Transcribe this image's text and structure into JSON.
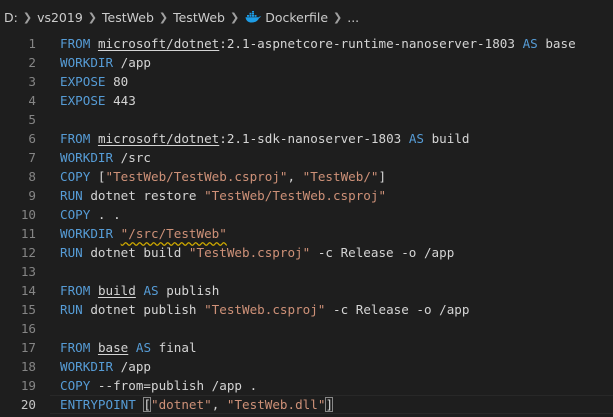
{
  "breadcrumb": [
    {
      "name": "drive",
      "label": "D:"
    },
    {
      "name": "vs2019",
      "label": "vs2019"
    },
    {
      "name": "testweb-folder",
      "label": "TestWeb"
    },
    {
      "name": "testweb-subfolder",
      "label": "TestWeb"
    },
    {
      "name": "dockerfile",
      "label": "Dockerfile",
      "icon": "docker-icon"
    },
    {
      "name": "symbols",
      "label": "..."
    }
  ],
  "colors": {
    "background": "#1e1e1e",
    "keyword": "#569cd6",
    "string": "#ce9178",
    "text": "#d4d4d4",
    "line_number": "#858585",
    "warning_squiggle": "#cca700"
  },
  "active_line": 20,
  "lines": [
    {
      "num": "1",
      "tokens": [
        {
          "t": "kw",
          "v": "FROM"
        },
        {
          "t": "plain",
          "v": " "
        },
        {
          "t": "plain-ul",
          "v": "microsoft/dotnet"
        },
        {
          "t": "plain",
          "v": ":2.1-aspnetcore-runtime-nanoserver-1803 "
        },
        {
          "t": "kw",
          "v": "AS"
        },
        {
          "t": "plain",
          "v": " base"
        }
      ]
    },
    {
      "num": "2",
      "tokens": [
        {
          "t": "kw",
          "v": "WORKDIR"
        },
        {
          "t": "plain",
          "v": " /app"
        }
      ]
    },
    {
      "num": "3",
      "tokens": [
        {
          "t": "kw",
          "v": "EXPOSE"
        },
        {
          "t": "plain",
          "v": " 80"
        }
      ]
    },
    {
      "num": "4",
      "tokens": [
        {
          "t": "kw",
          "v": "EXPOSE"
        },
        {
          "t": "plain",
          "v": " 443"
        }
      ]
    },
    {
      "num": "5",
      "tokens": []
    },
    {
      "num": "6",
      "tokens": [
        {
          "t": "kw",
          "v": "FROM"
        },
        {
          "t": "plain",
          "v": " "
        },
        {
          "t": "plain-ul",
          "v": "microsoft/dotnet"
        },
        {
          "t": "plain",
          "v": ":2.1-sdk-nanoserver-1803 "
        },
        {
          "t": "kw",
          "v": "AS"
        },
        {
          "t": "plain",
          "v": " build"
        }
      ]
    },
    {
      "num": "7",
      "tokens": [
        {
          "t": "kw",
          "v": "WORKDIR"
        },
        {
          "t": "plain",
          "v": " /src"
        }
      ]
    },
    {
      "num": "8",
      "tokens": [
        {
          "t": "kw",
          "v": "COPY"
        },
        {
          "t": "plain",
          "v": " ["
        },
        {
          "t": "str",
          "v": "\"TestWeb/TestWeb.csproj\""
        },
        {
          "t": "plain",
          "v": ", "
        },
        {
          "t": "str",
          "v": "\"TestWeb/\""
        },
        {
          "t": "plain",
          "v": "]"
        }
      ]
    },
    {
      "num": "9",
      "tokens": [
        {
          "t": "kw",
          "v": "RUN"
        },
        {
          "t": "plain",
          "v": " dotnet restore "
        },
        {
          "t": "str",
          "v": "\"TestWeb/TestWeb.csproj\""
        }
      ]
    },
    {
      "num": "10",
      "tokens": [
        {
          "t": "kw",
          "v": "COPY"
        },
        {
          "t": "plain",
          "v": " . ."
        }
      ]
    },
    {
      "num": "11",
      "tokens": [
        {
          "t": "kw",
          "v": "WORKDIR"
        },
        {
          "t": "plain",
          "v": " "
        },
        {
          "t": "str-squiggle",
          "v": "\"/src/TestWeb\""
        }
      ]
    },
    {
      "num": "12",
      "tokens": [
        {
          "t": "kw",
          "v": "RUN"
        },
        {
          "t": "plain",
          "v": " dotnet build "
        },
        {
          "t": "str",
          "v": "\"TestWeb.csproj\""
        },
        {
          "t": "plain",
          "v": " -c Release -o /app"
        }
      ]
    },
    {
      "num": "13",
      "tokens": []
    },
    {
      "num": "14",
      "tokens": [
        {
          "t": "kw",
          "v": "FROM"
        },
        {
          "t": "plain",
          "v": " "
        },
        {
          "t": "plain-ul",
          "v": "build"
        },
        {
          "t": "plain",
          "v": " "
        },
        {
          "t": "kw",
          "v": "AS"
        },
        {
          "t": "plain",
          "v": " publish"
        }
      ]
    },
    {
      "num": "15",
      "tokens": [
        {
          "t": "kw",
          "v": "RUN"
        },
        {
          "t": "plain",
          "v": " dotnet publish "
        },
        {
          "t": "str",
          "v": "\"TestWeb.csproj\""
        },
        {
          "t": "plain",
          "v": " -c Release -o /app"
        }
      ]
    },
    {
      "num": "16",
      "tokens": []
    },
    {
      "num": "17",
      "tokens": [
        {
          "t": "kw",
          "v": "FROM"
        },
        {
          "t": "plain",
          "v": " "
        },
        {
          "t": "plain-ul",
          "v": "base"
        },
        {
          "t": "plain",
          "v": " "
        },
        {
          "t": "kw",
          "v": "AS"
        },
        {
          "t": "plain",
          "v": " final"
        }
      ]
    },
    {
      "num": "18",
      "tokens": [
        {
          "t": "kw",
          "v": "WORKDIR"
        },
        {
          "t": "plain",
          "v": " /app"
        }
      ]
    },
    {
      "num": "19",
      "tokens": [
        {
          "t": "kw",
          "v": "COPY"
        },
        {
          "t": "plain",
          "v": " --from=publish /app ."
        }
      ]
    },
    {
      "num": "20",
      "tokens": [
        {
          "t": "kw",
          "v": "ENTRYPOINT"
        },
        {
          "t": "plain",
          "v": " "
        },
        {
          "t": "plain-br",
          "v": "["
        },
        {
          "t": "str",
          "v": "\"dotnet\""
        },
        {
          "t": "plain",
          "v": ", "
        },
        {
          "t": "str",
          "v": "\"TestWeb.dll\""
        },
        {
          "t": "plain-br",
          "v": "]"
        }
      ]
    }
  ]
}
